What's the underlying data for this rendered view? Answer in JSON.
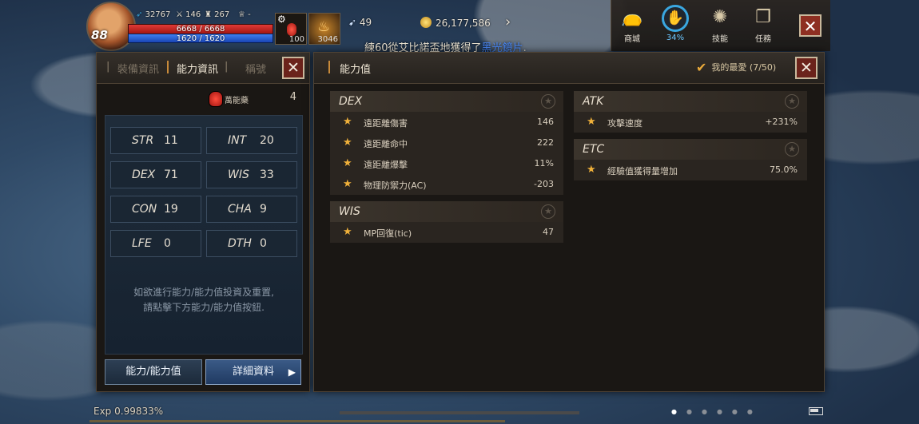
{
  "hud": {
    "level": "88",
    "stat1": "32767",
    "stat2": "146",
    "stat3": "267",
    "stat4": "-",
    "hp": "6668 / 6668",
    "mp": "1620 / 1620",
    "slot1_count": "100",
    "slot2_count": "3046",
    "feather": "49",
    "gold": "26,177,586",
    "notice_prefix": "練60從艾比諾盃地獲得了",
    "notice_item": "黑光鏡片",
    "notice_suffix": ".",
    "menu": [
      {
        "label": "商城",
        "icon": "shop-bag-icon"
      },
      {
        "label": "34%",
        "icon": "quest-progress-icon"
      },
      {
        "label": "技能",
        "icon": "skill-icon"
      },
      {
        "label": "任務",
        "icon": "scroll-icon"
      }
    ]
  },
  "left_panel": {
    "tabs": [
      "裝備資訊",
      "能力資訊",
      "稱號"
    ],
    "active_tab": "能力資訊",
    "potion_label": "萬能藥",
    "potion_count": "4",
    "stats": [
      {
        "name": "STR",
        "value": "11"
      },
      {
        "name": "INT",
        "value": "20"
      },
      {
        "name": "DEX",
        "value": "71"
      },
      {
        "name": "WIS",
        "value": "33"
      },
      {
        "name": "CON",
        "value": "19"
      },
      {
        "name": "CHA",
        "value": "9"
      },
      {
        "name": "LFE",
        "value": "0"
      },
      {
        "name": "DTH",
        "value": "0"
      }
    ],
    "hint_line1": "如欲進行能力/能力值投資及重置,",
    "hint_line2": "請點擊下方能力/能力值按鈕.",
    "button_ability": "能力/能力值",
    "button_detail": "詳細資料"
  },
  "right_panel": {
    "title": "能力值",
    "favorite_label": "我的最愛 (7/50)",
    "groups": [
      {
        "title": "DEX",
        "rows": [
          {
            "name": "遠距離傷害",
            "value": "146"
          },
          {
            "name": "遠距離命中",
            "value": "222"
          },
          {
            "name": "遠距離爆擊",
            "value": "11%"
          },
          {
            "name": "物理防禦力(AC)",
            "value": "-203"
          }
        ]
      },
      {
        "title": "WIS",
        "rows": [
          {
            "name": "MP回復(tic)",
            "value": "47"
          }
        ]
      },
      {
        "title": "ATK",
        "rows": [
          {
            "name": "攻擊速度",
            "value": "+231%"
          }
        ]
      },
      {
        "title": "ETC",
        "rows": [
          {
            "name": "經驗值獲得量增加",
            "value": "75.0%"
          }
        ]
      }
    ]
  },
  "footer": {
    "exp": "Exp 0.99833%"
  },
  "colors": {
    "accent": "#c88a3a",
    "star": "#f0b13a",
    "hp": "#e03a36",
    "mp": "#3f7ff0",
    "close_bg": "#6b231b"
  }
}
